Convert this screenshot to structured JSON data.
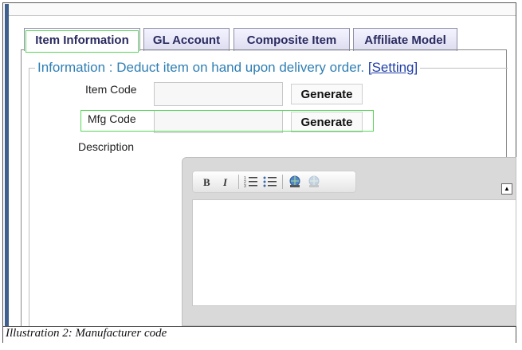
{
  "tabs": [
    {
      "label": "Item Information",
      "active": true
    },
    {
      "label": "GL Account",
      "active": false
    },
    {
      "label": "Composite Item",
      "active": false
    },
    {
      "label": "Affiliate Model",
      "active": false
    }
  ],
  "info": {
    "text": "Information : Deduct item on hand upon delivery order. ",
    "setting_link": "[Setting]"
  },
  "fields": {
    "item_code": {
      "label": "Item Code",
      "value": "",
      "button": "Generate"
    },
    "mfg_code": {
      "label": "Mfg Code",
      "value": "",
      "button": "Generate"
    },
    "description": {
      "label": "Description"
    }
  },
  "editor": {
    "toolbar": [
      "bold-icon",
      "italic-icon",
      "numbered-list-icon",
      "bullet-list-icon",
      "link-icon",
      "unlink-icon"
    ],
    "collapse_glyph": "▲"
  },
  "caption": "Illustration 2: Manufacturer code",
  "colors": {
    "info_text": "#2f7fb4",
    "tab_text": "#2a2a60",
    "highlight": "#59d659"
  }
}
